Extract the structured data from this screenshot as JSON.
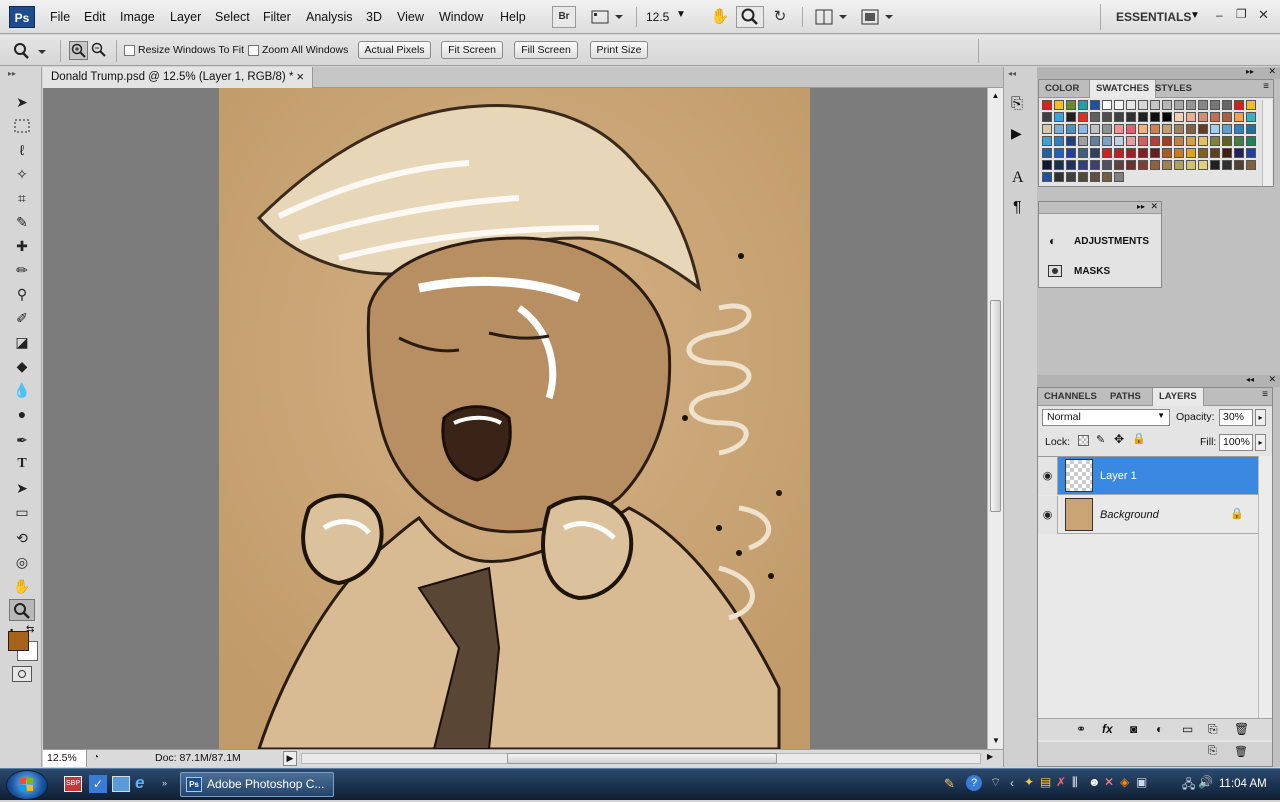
{
  "menubar": {
    "logo": "Ps",
    "menus": [
      "File",
      "Edit",
      "Image",
      "Layer",
      "Select",
      "Filter",
      "Analysis",
      "3D",
      "View",
      "Window",
      "Help"
    ],
    "bridge_label": "Br",
    "zoom_value": "12.5",
    "workspace": "ESSENTIALS"
  },
  "options": {
    "resize_windows_label": "Resize Windows To Fit",
    "zoom_all_label": "Zoom All Windows",
    "actual_pixels": "Actual Pixels",
    "fit_screen": "Fit Screen",
    "fill_screen": "Fill Screen",
    "print_size": "Print Size"
  },
  "document": {
    "tab_title": "Donald Trump.psd @ 12.5% (Layer 1, RGB/8) *",
    "close_glyph": "×"
  },
  "status": {
    "zoom": "12.5%",
    "doc_size": "Doc: 87.1M/87.1M"
  },
  "panels": {
    "color_tabs": [
      "COLOR",
      "SWATCHES",
      "STYLES"
    ],
    "active_color_tab": "SWATCHES",
    "adjustments_label": "ADJUSTMENTS",
    "masks_label": "MASKS",
    "layer_tabs": [
      "CHANNELS",
      "PATHS",
      "LAYERS"
    ],
    "active_layer_tab": "LAYERS",
    "blend_mode": "Normal",
    "opacity_label": "Opacity:",
    "opacity_value": "30%",
    "lock_label": "Lock:",
    "fill_label": "Fill:",
    "fill_value": "100%",
    "layers": [
      {
        "name": "Layer 1",
        "selected": true
      },
      {
        "name": "Background",
        "selected": false
      }
    ]
  },
  "taskbar": {
    "app_button": "Adobe Photoshop C...",
    "clock": "11:04 AM"
  },
  "colors": {
    "foreground": "#a8631a",
    "background": "#ffffff",
    "selection": "#3b88e0",
    "canvas_paper": "#c9a575"
  },
  "swatch_palette": [
    "#e02020",
    "#f0c020",
    "#6a8a2a",
    "#20a0a0",
    "#2050a0",
    "#ffffff",
    "#f4f4f4",
    "#e6e6e6",
    "#d6d6d6",
    "#c6c6c6",
    "#b6b6b6",
    "#a6a6a6",
    "#969696",
    "#868686",
    "#767676",
    "#666666",
    "#d02020",
    "#f0c020",
    "#404040",
    "#3aa0e0",
    "#202020",
    "#e03020",
    "#606060",
    "#505050",
    "#404040",
    "#303030",
    "#202020",
    "#101010",
    "#000000",
    "#f2d0b0",
    "#e8b090",
    "#d09070",
    "#c07050",
    "#a86040",
    "#f0a050",
    "#40b0c0",
    "#d8c8a8",
    "#7ab0d8",
    "#5090c0",
    "#8ab8e8",
    "#c0c0c0",
    "#909090",
    "#f09090",
    "#e06070",
    "#f0b080",
    "#d08050",
    "#c0a070",
    "#a08060",
    "#806040",
    "#604020",
    "#a0d0f0",
    "#60a0d0",
    "#3080c0",
    "#2070a0",
    "#40a0d0",
    "#3080c0",
    "#204080",
    "#a0a0a0",
    "#6080a0",
    "#80a0c0",
    "#c0d0e0",
    "#e0a0a0",
    "#d06060",
    "#b04040",
    "#a04020",
    "#c08040",
    "#d0a040",
    "#e0c060",
    "#808040",
    "#606020",
    "#408040",
    "#208060",
    "#2060a0",
    "#2060c0",
    "#2040a0",
    "#406080",
    "#304060",
    "#d02020",
    "#c02020",
    "#a02020",
    "#802020",
    "#602020",
    "#a06020",
    "#c08020",
    "#e0a020",
    "#806020",
    "#604020",
    "#402010",
    "#202060",
    "#2040a0",
    "#101830",
    "#183050",
    "#203060",
    "#304080",
    "#404070",
    "#505060",
    "#604040",
    "#703030",
    "#804030",
    "#906040",
    "#a08050",
    "#b0a060",
    "#d0c070",
    "#e0d080",
    "#202020",
    "#303030",
    "#504030",
    "#806040",
    "#2050a0",
    "#303030",
    "#404040",
    "#504838",
    "#605040",
    "#706040",
    "#808080"
  ]
}
